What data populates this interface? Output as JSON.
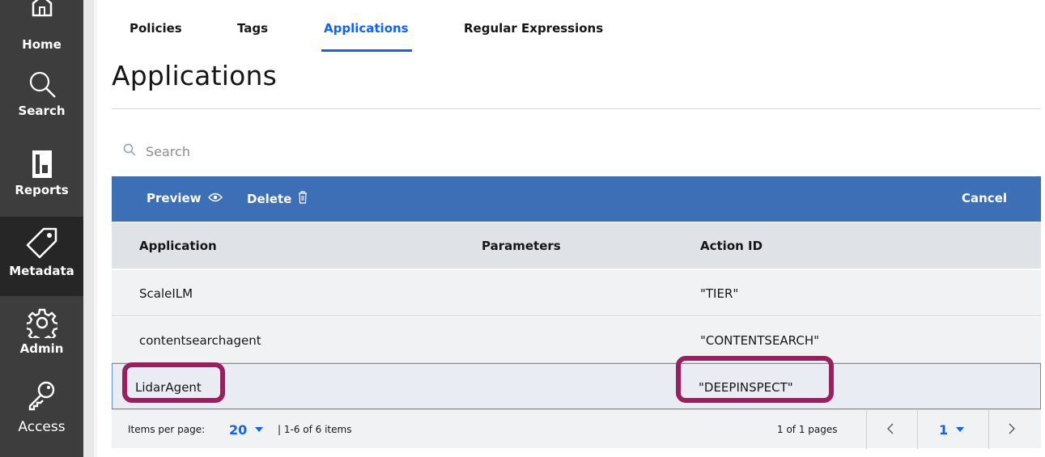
{
  "sidebar": {
    "items": [
      {
        "label": "Home",
        "icon": "home-icon"
      },
      {
        "label": "Search",
        "icon": "search-icon"
      },
      {
        "label": "Reports",
        "icon": "reports-icon"
      },
      {
        "label": "Metadata",
        "icon": "tag-icon",
        "active": true
      },
      {
        "label": "Admin",
        "icon": "gear-icon"
      },
      {
        "label": "Access",
        "icon": "key-icon"
      }
    ]
  },
  "tabs": [
    {
      "label": "Policies"
    },
    {
      "label": "Tags"
    },
    {
      "label": "Applications",
      "active": true
    },
    {
      "label": "Regular Expressions"
    }
  ],
  "page_title": "Applications",
  "search": {
    "placeholder": "Search"
  },
  "action_bar": {
    "preview_label": "Preview",
    "delete_label": "Delete",
    "cancel_label": "Cancel"
  },
  "table": {
    "columns": [
      "Application",
      "Parameters",
      "Action ID"
    ],
    "rows": [
      {
        "application": "ScaleILM",
        "parameters": "",
        "action_id": "\"TIER\""
      },
      {
        "application": "contentsearchagent",
        "parameters": "",
        "action_id": "\"CONTENTSEARCH\""
      },
      {
        "application": "LidarAgent",
        "parameters": "",
        "action_id": "\"DEEPINSPECT\"",
        "selected": true
      }
    ]
  },
  "pagination": {
    "items_per_page_label": "Items per page:",
    "items_per_page_value": "20",
    "range_text": "| 1-6 of 6 items",
    "pages_text": "1 of 1 pages",
    "current_page": "1"
  },
  "colors": {
    "accent": "#0f62fe",
    "action_bar": "#3d6fb6",
    "sidebar": "#3d3d3d",
    "highlight_box": "#9b1f5e"
  }
}
